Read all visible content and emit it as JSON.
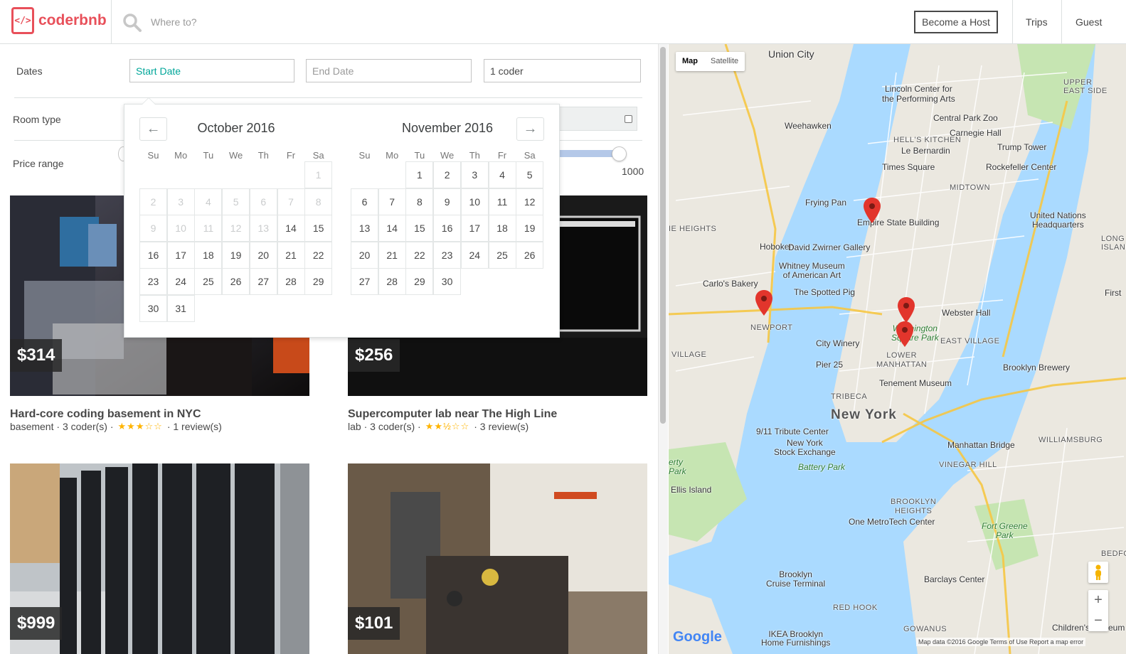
{
  "header": {
    "logo_glyph": "</>",
    "logo_text": "coderbnb",
    "search_placeholder": "Where to?",
    "become_host": "Become a Host",
    "trips": "Trips",
    "guest": "Guest"
  },
  "filters": {
    "dates_label": "Dates",
    "start_placeholder": "Start Date",
    "end_placeholder": "End Date",
    "guests_value": "1 coder",
    "room_type_label": "Room type",
    "price_label": "Price range",
    "price_max": "1000"
  },
  "datepicker": {
    "prev_icon": "←",
    "next_icon": "→",
    "weekdays": [
      "Su",
      "Mo",
      "Tu",
      "We",
      "Th",
      "Fr",
      "Sa"
    ],
    "months": [
      {
        "title": "October 2016",
        "first_weekday": 6,
        "days_in_month": 31,
        "blocked_until": 13
      },
      {
        "title": "November 2016",
        "first_weekday": 2,
        "days_in_month": 30,
        "blocked_until": 0
      }
    ]
  },
  "listings": [
    {
      "price": "$314",
      "title": "Hard-core coding basement in NYC",
      "type": "basement",
      "coders": "3 coder(s)",
      "stars": "★★★☆☆",
      "reviews": "1 review(s)"
    },
    {
      "price": "$256",
      "title": "Supercomputer lab near The High Line",
      "type": "lab",
      "coders": "3 coder(s)",
      "stars": "★★½☆☆",
      "reviews": "3 review(s)"
    },
    {
      "price": "$999",
      "title": "",
      "type": "",
      "coders": "",
      "stars": "",
      "reviews": ""
    },
    {
      "price": "$101",
      "title": "",
      "type": "",
      "coders": "",
      "stars": "",
      "reviews": ""
    }
  ],
  "map": {
    "type_map": "Map",
    "type_satellite": "Satellite",
    "zoom_in": "+",
    "zoom_out": "−",
    "google": "Google",
    "footer": "Map data ©2016 Google   Terms of Use   Report a map error",
    "labels": {
      "union_city": "Union City",
      "weehawken": "Weehawken",
      "hoboken": "Hoboken",
      "newport": "NEWPORT",
      "new_york": "New York",
      "lincoln_center": "Lincoln Center for\nthe Performing Arts",
      "central_park_zoo": "Central Park Zoo",
      "carnegie_hall": "Carnegie Hall",
      "hells_kitchen": "HELL'S KITCHEN",
      "le_bernardin": "Le Bernardin",
      "trump_tower": "Trump Tower",
      "times_square": "Times Square",
      "rockefeller": "Rockefeller Center",
      "midtown": "MIDTOWN",
      "empire_state": "Empire State Building",
      "frying_pan": "Frying Pan",
      "un_hq": "United Nations\nHeadquarters",
      "david_zwirner": "David Zwirner Gallery",
      "whitney": "Whitney Museum\nof American Art",
      "carlos_bakery": "Carlo's Bakery",
      "spotted_pig": "The Spotted Pig",
      "webster_hall": "Webster Hall",
      "washington_sq": "Washington\nSquare Park",
      "east_village": "EAST VILLAGE",
      "city_winery": "City Winery",
      "pier_25": "Pier 25",
      "lower_manhattan": "LOWER\nMANHATTAN",
      "brooklyn_brewery": "Brooklyn Brewery",
      "tenement": "Tenement Museum",
      "tribeca": "TRIBECA",
      "tribute": "9/11 Tribute Center",
      "nyse": "New York\nStock Exchange",
      "battery_park": "Battery Park",
      "manhattan_bridge": "Manhattan Bridge",
      "williamsburg": "WILLIAMSBURG",
      "vinegar_hill": "VINEGAR HILL",
      "ellis_island": "Ellis Island",
      "brooklyn_heights": "BROOKLYN\nHEIGHTS",
      "metrotech": "One MetroTech Center",
      "fort_greene": "Fort Greene\nPark",
      "brooklyn_cruise": "Brooklyn\nCruise Terminal",
      "barclays": "Barclays Center",
      "red_hook": "RED HOOK",
      "gowanus": "GOWANUS",
      "ikea": "IKEA Brooklyn\nHome Furnishings",
      "childrens": "Children's Museum",
      "upper_east": "UPPER\nEAST SIDE",
      "village": "VILLAGE",
      "heights": "IE HEIGHTS",
      "long_island": "LONG\nISLAND C",
      "liberty": "erty\nPark",
      "bedford": "BEDFOR",
      "first": "First"
    }
  }
}
